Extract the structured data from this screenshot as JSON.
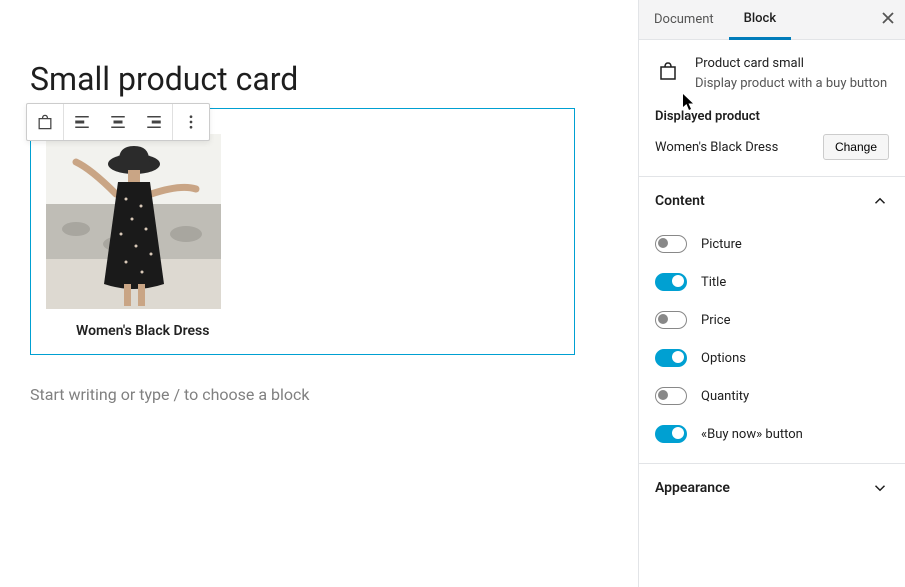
{
  "editor": {
    "page_title": "Small product card",
    "placeholder": "Start writing or type / to choose a block",
    "product": {
      "name": "Women's Black Dress"
    }
  },
  "sidebar": {
    "tabs": {
      "document": "Document",
      "block": "Block"
    },
    "block_info": {
      "title": "Product card small",
      "description": "Display product with a buy button"
    },
    "displayed_product": {
      "heading": "Displayed product",
      "value": "Women's Black Dress",
      "button": "Change"
    },
    "content_panel": {
      "title": "Content",
      "rows": {
        "picture": {
          "label": "Picture",
          "on": false
        },
        "title": {
          "label": "Title",
          "on": true
        },
        "price": {
          "label": "Price",
          "on": false
        },
        "options": {
          "label": "Options",
          "on": true
        },
        "quantity": {
          "label": "Quantity",
          "on": false
        },
        "buy": {
          "label": "«Buy now» button",
          "on": true
        }
      }
    },
    "appearance_panel": {
      "title": "Appearance"
    }
  }
}
